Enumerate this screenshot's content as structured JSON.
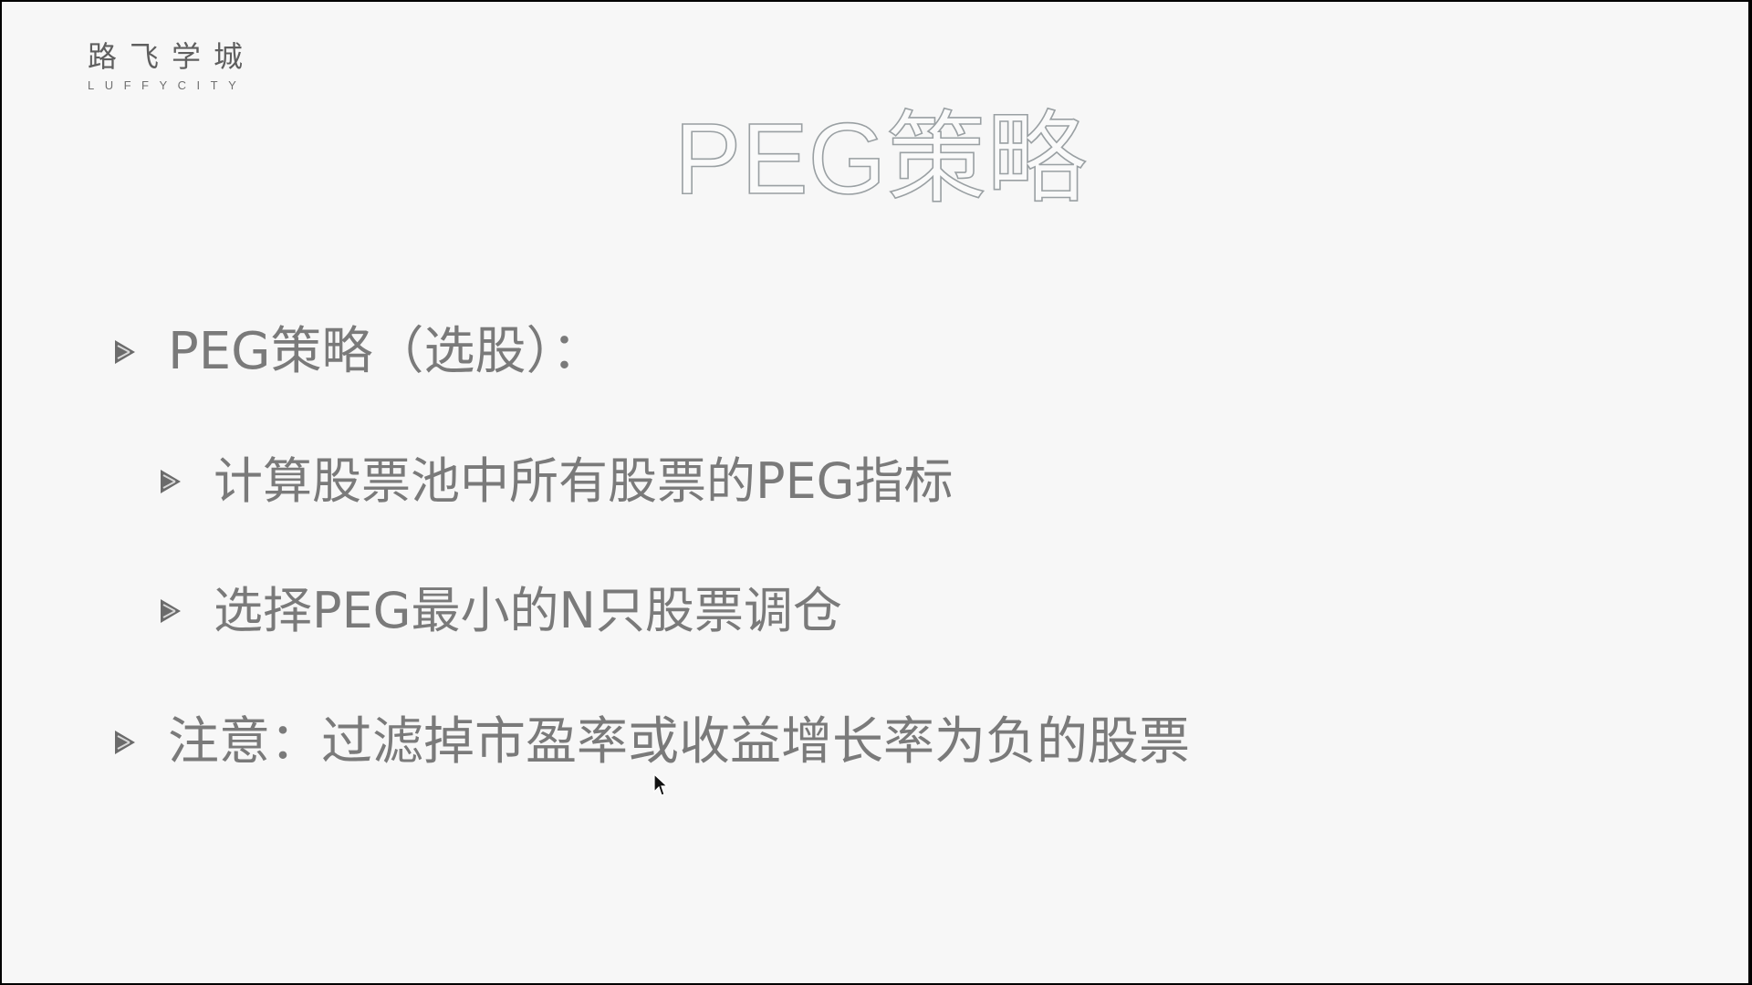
{
  "logo": {
    "cn": "路飞学城",
    "en": "LUFFYCITY"
  },
  "title": "PEG策略",
  "bullets": [
    {
      "level": 1,
      "text": "PEG策略（选股）："
    },
    {
      "level": 2,
      "text": "计算股票池中所有股票的PEG指标"
    },
    {
      "level": 2,
      "text": "选择PEG最小的N只股票调仓"
    },
    {
      "level": 1,
      "text": "注意：过滤掉市盈率或收益增长率为负的股票"
    }
  ],
  "colors": {
    "background": "#f7f7f7",
    "border": "#000000",
    "text": "#7a7a7a",
    "marker": "#6b6b6b"
  },
  "icons": {
    "bullet": "triangle-bullet-icon",
    "cursor": "mouse-pointer-icon"
  }
}
